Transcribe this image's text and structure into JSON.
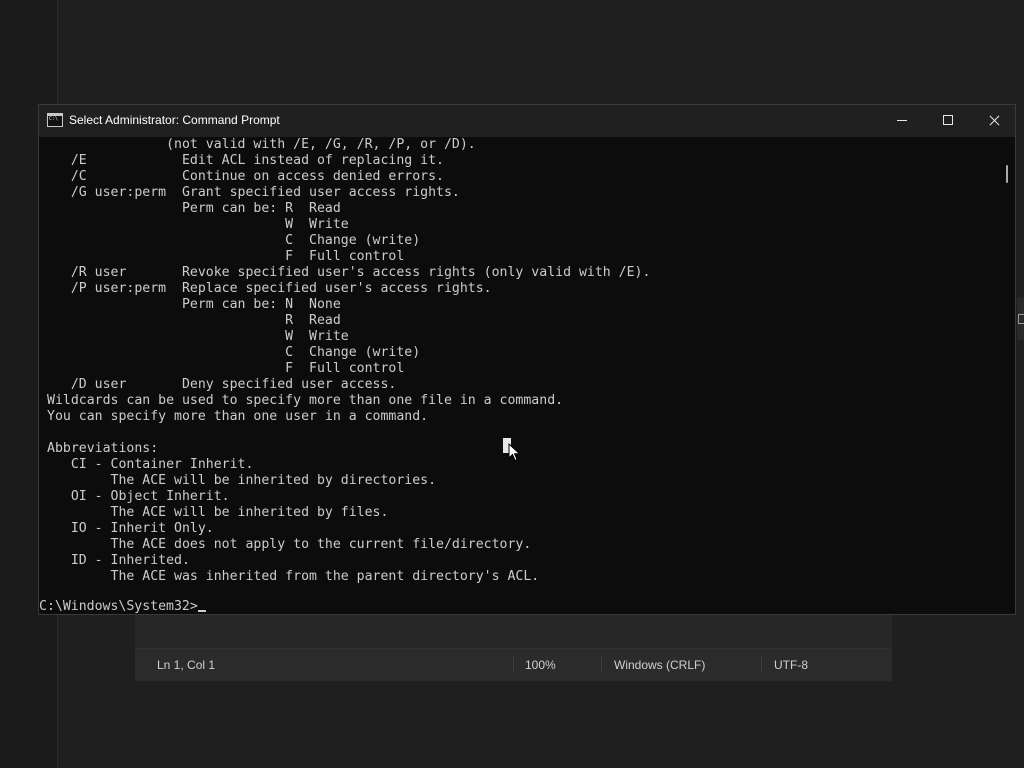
{
  "background_window": {
    "status_bar": {
      "position": "Ln 1, Col 1",
      "zoom": "100%",
      "line_ending": "Windows (CRLF)",
      "encoding": "UTF-8"
    }
  },
  "window": {
    "title": "Select Administrator:  Command Prompt",
    "icon": "cmd-icon",
    "controls": [
      "minimize-icon",
      "maximize-icon",
      "close-icon"
    ]
  },
  "console": {
    "lines": [
      "               (not valid with /E, /G, /R, /P, or /D).",
      "   /E            Edit ACL instead of replacing it.",
      "   /C            Continue on access denied errors.",
      "   /G user:perm  Grant specified user access rights.",
      "                 Perm can be: R  Read",
      "                              W  Write",
      "                              C  Change (write)",
      "                              F  Full control",
      "   /R user       Revoke specified user's access rights (only valid with /E).",
      "   /P user:perm  Replace specified user's access rights.",
      "                 Perm can be: N  None",
      "                              R  Read",
      "                              W  Write",
      "                              C  Change (write)",
      "                              F  Full control",
      "   /D user       Deny specified user access.",
      "Wildcards can be used to specify more than one file in a command.",
      "You can specify more than one user in a command.",
      "",
      "Abbreviations:",
      "   CI - Container Inherit.",
      "        The ACE will be inherited by directories.",
      "   OI - Object Inherit.",
      "        The ACE will be inherited by files.",
      "   IO - Inherit Only.",
      "        The ACE does not apply to the current file/directory.",
      "   ID - Inherited.",
      "        The ACE was inherited from the parent directory's ACL."
    ],
    "prompt": "C:\\Windows\\System32>"
  },
  "colors": {
    "console_bg": "#0c0c0c",
    "console_fg": "#cccccc",
    "titlebar_bg": "#202020",
    "desktop_bg": "#1b1b1b"
  }
}
